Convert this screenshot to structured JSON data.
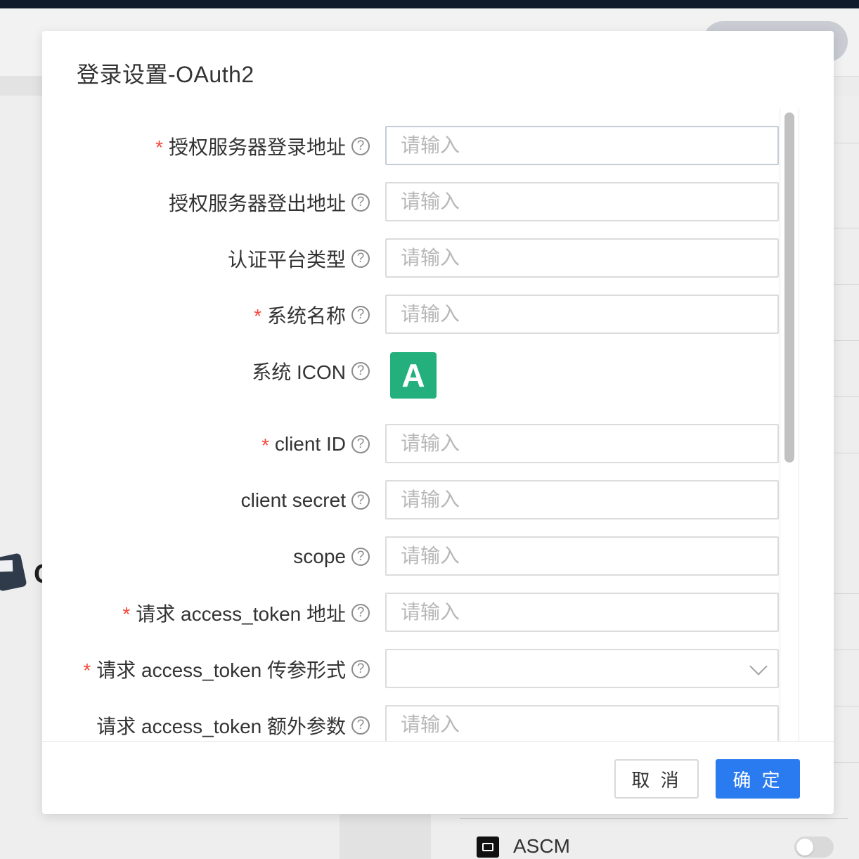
{
  "background": {
    "app_item_label": "ASCM",
    "partial_letter": "C"
  },
  "modal": {
    "title": "登录设置-OAuth2",
    "fields": [
      {
        "label": "授权服务器登录地址",
        "required": true,
        "placeholder": "请输入",
        "type": "input"
      },
      {
        "label": "授权服务器登出地址",
        "required": false,
        "placeholder": "请输入",
        "type": "input"
      },
      {
        "label": "认证平台类型",
        "required": false,
        "placeholder": "请输入",
        "type": "input"
      },
      {
        "label": "系统名称",
        "required": true,
        "placeholder": "请输入",
        "type": "input"
      },
      {
        "label": "系统 ICON",
        "required": false,
        "type": "icon",
        "icon_letter": "A",
        "icon_color": "#23b07d"
      },
      {
        "label": "client ID",
        "required": true,
        "placeholder": "请输入",
        "type": "input"
      },
      {
        "label": "client secret",
        "required": false,
        "placeholder": "请输入",
        "type": "input"
      },
      {
        "label": "scope",
        "required": false,
        "placeholder": "请输入",
        "type": "input"
      },
      {
        "label": "请求 access_token 地址",
        "required": true,
        "placeholder": "请输入",
        "type": "input"
      },
      {
        "label": "请求 access_token 传参形式",
        "required": true,
        "placeholder": "",
        "type": "select"
      },
      {
        "label": "请求 access_token 额外参数",
        "required": false,
        "placeholder": "请输入",
        "type": "input"
      }
    ],
    "required_mark": "*",
    "help_glyph": "?",
    "buttons": {
      "cancel": "取 消",
      "confirm": "确 定"
    },
    "colors": {
      "primary": "#2a7bf0",
      "required": "#f5483b",
      "icon_tile": "#23b07d"
    }
  }
}
